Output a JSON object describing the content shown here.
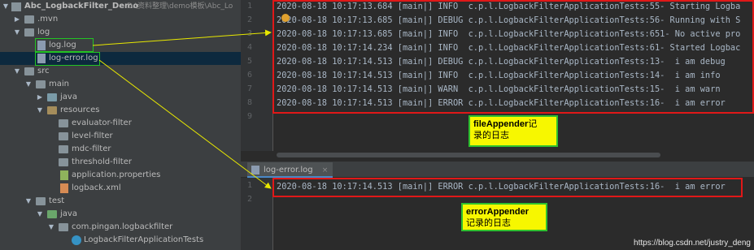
{
  "tree": {
    "project_name": "Abc_LogbackFilter_Demo",
    "project_path": "D:\\资料整理\\demo模板\\Abc_Lo",
    "mvn": ".mvn",
    "log_folder": "log",
    "log_file": "log.log",
    "log_error_file": "log-error.log",
    "src": "src",
    "main": "main",
    "java": "java",
    "resources": "resources",
    "evaluator": "evaluator-filter",
    "level": "level-filter",
    "mdc": "mdc-filter",
    "threshold": "threshold-filter",
    "app_props": "application.properties",
    "logback": "logback.xml",
    "test": "test",
    "test_java": "java",
    "package": "com.pingan.logbackfilter",
    "test_class": "LogbackFilterApplicationTests"
  },
  "editor1": {
    "line_numbers": [
      "1",
      "2",
      "3",
      "4",
      "5",
      "6",
      "7",
      "8",
      "9"
    ],
    "lines": [
      "2020-08-18 10:17:13.684 [main|] INFO  c.p.l.LogbackFilterApplicationTests:55- Starting Logba",
      "2020-08-18 10:17:13.685 [main|] DEBUG c.p.l.LogbackFilterApplicationTests:56- Running with S",
      "2020-08-18 10:17:13.685 [main|] INFO  c.p.l.LogbackFilterApplicationTests:651- No active pro",
      "2020-08-18 10:17:14.234 [main|] INFO  c.p.l.LogbackFilterApplicationTests:61- Started Logbac",
      "2020-08-18 10:17:14.513 [main|] DEBUG c.p.l.LogbackFilterApplicationTests:13-  i am debug",
      "2020-08-18 10:17:14.513 [main|] INFO  c.p.l.LogbackFilterApplicationTests:14-  i am info",
      "2020-08-18 10:17:14.513 [main|] WARN  c.p.l.LogbackFilterApplicationTests:15-  i am warn",
      "2020-08-18 10:17:14.513 [main|] ERROR c.p.l.LogbackFilterApplicationTests:16-  i am error"
    ]
  },
  "tab": {
    "label": "log-error.log",
    "close": "×"
  },
  "editor2": {
    "line_numbers": [
      "1",
      "2"
    ],
    "lines": [
      "2020-08-18 10:17:14.513 [main|] ERROR c.p.l.LogbackFilterApplicationTests:16-  i am error"
    ]
  },
  "callout1": {
    "title": "fileAppender",
    "rest": "记",
    "line2": "录的日志"
  },
  "callout2": {
    "title": "errorAppender",
    "line2": "记录的日志"
  },
  "watermark": "https://blog.csdn.net/justry_deng",
  "colors": {
    "annotation_box": "#e01818",
    "callout_bg": "#f7f700",
    "callout_border": "#2ec02e",
    "arrow": "#e8e800"
  }
}
